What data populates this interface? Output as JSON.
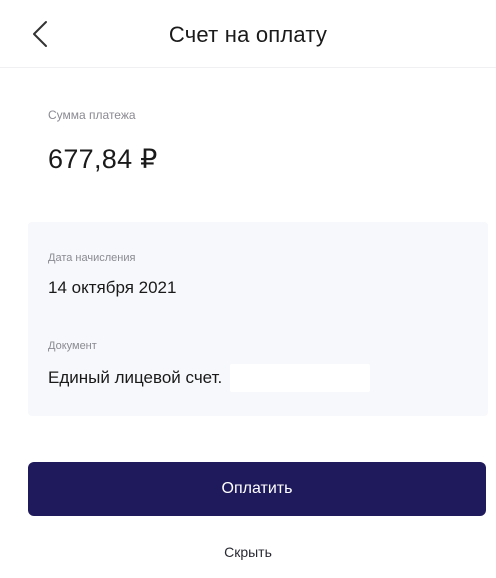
{
  "header": {
    "title": "Счет на оплату",
    "back_icon": "chevron-left-icon"
  },
  "amount": {
    "label": "Сумма платежа",
    "value": "677,84 ₽"
  },
  "details": {
    "accrual_date_label": "Дата начисления",
    "accrual_date_value": "14 октября 2021",
    "document_label": "Документ",
    "document_value": "Единый лицевой счет."
  },
  "actions": {
    "pay_label": "Оплатить",
    "hide_label": "Скрыть"
  },
  "colors": {
    "primary": "#1f1a5c",
    "panel_bg": "#f7f8fb",
    "label_gray": "#8a8a92"
  }
}
